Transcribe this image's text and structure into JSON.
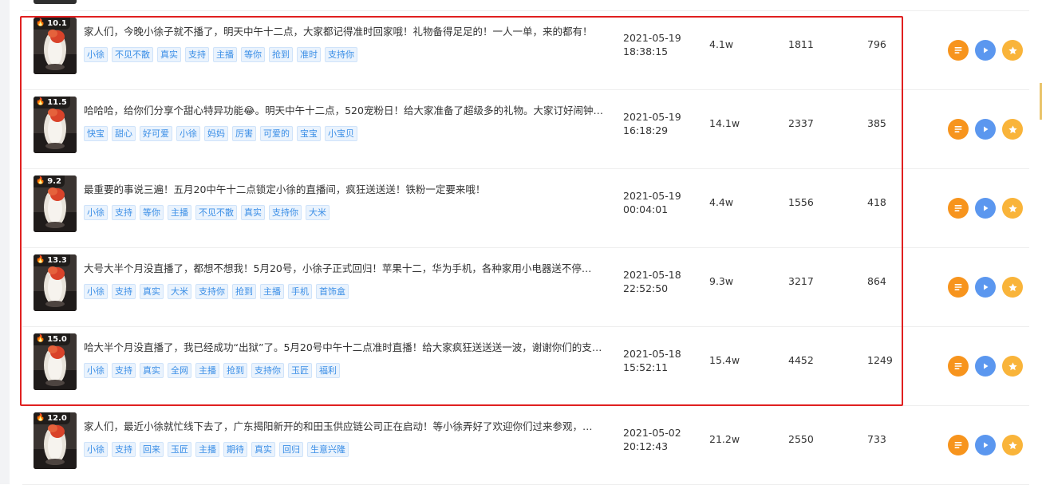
{
  "rows": [
    {
      "heat": "10.1",
      "title": "家人们，今晚小徐子就不播了，明天中午十二点，大家都记得准时回家哦！礼物备得足足的！一人一单，来的都有！",
      "tags": [
        "小徐",
        "不见不散",
        "真实",
        "支持",
        "主播",
        "等你",
        "抢到",
        "准时",
        "支持你"
      ],
      "date": "2021-05-19",
      "time": "18:38:15",
      "views": "4.1w",
      "likes": "1811",
      "comments": "796"
    },
    {
      "heat": "11.5",
      "title": "哈哈哈，给你们分享个甜心特异功能😂。明天中午十二点，520宠粉日！给大家准备了超级多的礼物。大家订好闹钟…",
      "tags": [
        "快宝",
        "甜心",
        "好可爱",
        "小徐",
        "妈妈",
        "厉害",
        "可爱的",
        "宝宝",
        "小宝贝"
      ],
      "date": "2021-05-19",
      "time": "16:18:29",
      "views": "14.1w",
      "likes": "2337",
      "comments": "385"
    },
    {
      "heat": "9.2",
      "title": "最重要的事说三遍！五月20中午十二点锁定小徐的直播间，疯狂送送送！铁粉一定要来哦！",
      "tags": [
        "小徐",
        "支持",
        "等你",
        "主播",
        "不见不散",
        "真实",
        "支持你",
        "大米"
      ],
      "date": "2021-05-19",
      "time": "00:04:01",
      "views": "4.4w",
      "likes": "1556",
      "comments": "418"
    },
    {
      "heat": "13.3",
      "title": "大号大半个月没直播了，都想不想我！5月20号，小徐子正式回归！苹果十二，华为手机，各种家用小电器送不停…",
      "tags": [
        "小徐",
        "支持",
        "真实",
        "大米",
        "支持你",
        "抢到",
        "主播",
        "手机",
        "首饰盒"
      ],
      "date": "2021-05-18",
      "time": "22:52:50",
      "views": "9.3w",
      "likes": "3217",
      "comments": "864"
    },
    {
      "heat": "15.0",
      "title": "哈大半个月没直播了，我已经成功“出狱”了。5月20号中午十二点准时直播！给大家疯狂送送送一波，谢谢你们的支…",
      "tags": [
        "小徐",
        "支持",
        "真实",
        "全网",
        "主播",
        "抢到",
        "支持你",
        "玉匠",
        "福利"
      ],
      "date": "2021-05-18",
      "time": "15:52:11",
      "views": "15.4w",
      "likes": "4452",
      "comments": "1249"
    },
    {
      "heat": "12.0",
      "title": "家人们，最近小徐就忙线下去了，广东揭阳新开的和田玉供应链公司正在启动！等小徐弄好了欢迎你们过来参观，…",
      "tags": [
        "小徐",
        "支持",
        "回来",
        "玉匠",
        "主播",
        "期待",
        "真实",
        "回归",
        "生意兴隆"
      ],
      "date": "2021-05-02",
      "time": "20:12:43",
      "views": "21.2w",
      "likes": "2550",
      "comments": "733"
    }
  ],
  "icons": {
    "heat": "flame-icon",
    "detail": "list-icon",
    "play": "play-icon",
    "favorite": "star-icon"
  },
  "colors": {
    "highlight_border": "#e02020",
    "tag_bg": "#eaf3fd",
    "tag_text": "#3a8ee6",
    "detail_button": "#f7941d",
    "play_button": "#5b97ef",
    "favorite_button": "#f9b43a"
  }
}
